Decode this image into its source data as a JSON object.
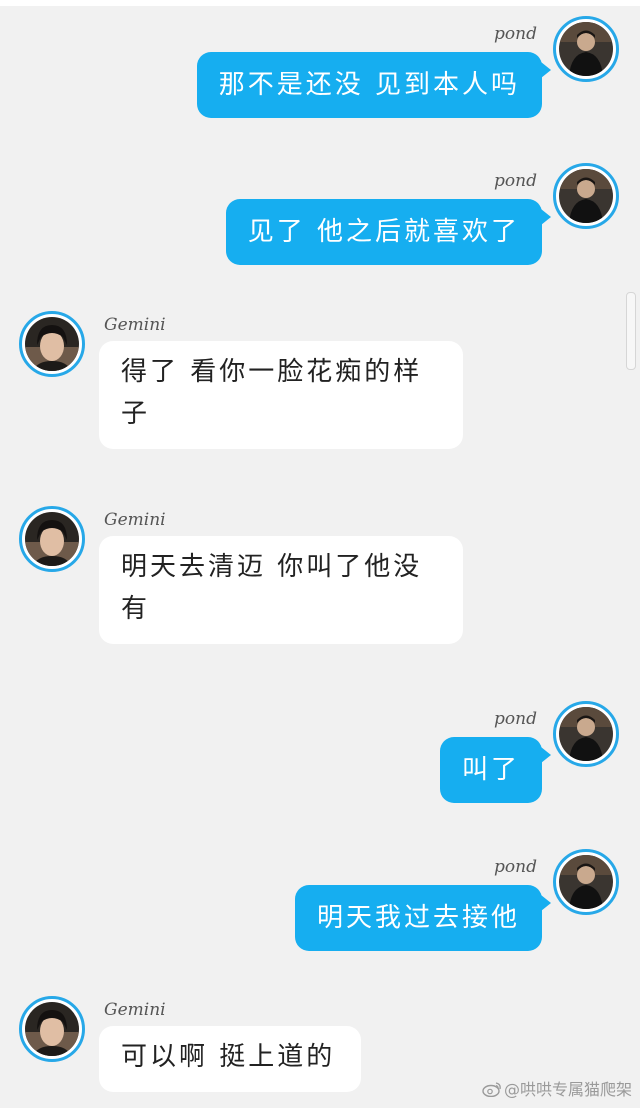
{
  "messages": [
    {
      "side": "right",
      "name": "pond",
      "text": "那不是还没 见到本人吗",
      "avatar": "user-avatar-pond"
    },
    {
      "side": "right",
      "name": "pond",
      "text": "见了 他之后就喜欢了",
      "avatar": "user-avatar-pond"
    },
    {
      "side": "left",
      "name": "Gemini",
      "text": "得了 看你一脸花痴的样子",
      "avatar": "contact-avatar-gemini"
    },
    {
      "side": "left",
      "name": "Gemini",
      "text": "明天去清迈 你叫了他没有",
      "avatar": "contact-avatar-gemini"
    },
    {
      "side": "right",
      "name": "pond",
      "text": "叫了",
      "avatar": "user-avatar-pond"
    },
    {
      "side": "right",
      "name": "pond",
      "text": "明天我过去接他",
      "avatar": "user-avatar-pond"
    },
    {
      "side": "left",
      "name": "Gemini",
      "text": "可以啊 挺上道的",
      "avatar": "contact-avatar-gemini"
    }
  ],
  "watermark": {
    "text": "@哄哄专属猫爬架",
    "icon": "weibo-icon"
  },
  "colors": {
    "background": "#f1f1f1",
    "outgoing_bubble": "#16aef0",
    "incoming_bubble": "#ffffff",
    "avatar_ring": "#27a8e8"
  }
}
